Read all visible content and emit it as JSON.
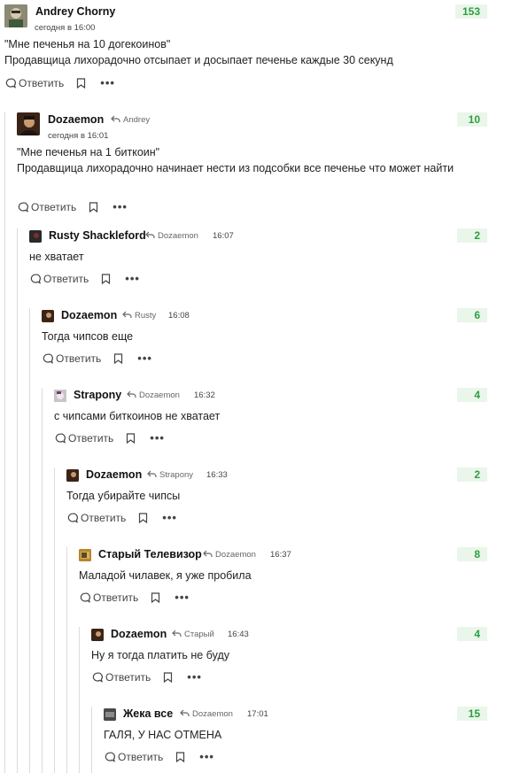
{
  "labels": {
    "reply": "Ответить"
  },
  "colors": {
    "rating_bg": "#e9f6e9",
    "rating_text": "#2f9e41",
    "thread_line": "#dcdcdc"
  },
  "comments": [
    {
      "author": "Andrey Chorny",
      "time": "сегодня в 16:00",
      "rating": "153",
      "text": "\"Мне печенья на 10 догекоинов\"\nПродавщица лихорадочно отсыпает и досыпает печенье каждые 30 секунд",
      "avatar_icon": "person-avatar-icon"
    },
    {
      "author": "Dozaemon",
      "reply_to": "Andrey",
      "time": "сегодня в 16:01",
      "rating": "10",
      "text": "\"Мне печенья на 1 биткоин\"\nПродавщица лихорадочно начинает нести из подсобки все печенье что может найти",
      "avatar_icon": "painting-avatar-icon"
    },
    {
      "author": "Rusty Shackleford",
      "reply_to": "Dozaemon",
      "time": "16:07",
      "rating": "2",
      "text": "не хватает",
      "avatar_icon": "dark-avatar-icon"
    },
    {
      "author": "Dozaemon",
      "reply_to": "Rusty",
      "time": "16:08",
      "rating": "6",
      "text": "Тогда чипсов еще",
      "avatar_icon": "painting-avatar-icon"
    },
    {
      "author": "Strapony",
      "reply_to": "Dozaemon",
      "time": "16:32",
      "rating": "4",
      "text": "с чипсами биткоинов не хватает",
      "avatar_icon": "pony-avatar-icon"
    },
    {
      "author": "Dozaemon",
      "reply_to": "Strapony",
      "time": "16:33",
      "rating": "2",
      "text": "Тогда убирайте чипсы",
      "avatar_icon": "painting-avatar-icon"
    },
    {
      "author": "Старый Телевизор",
      "reply_to": "Dozaemon",
      "time": "16:37",
      "rating": "8",
      "text": "Маладой чилавек, я уже пробила",
      "avatar_icon": "tv-avatar-icon"
    },
    {
      "author": "Dozaemon",
      "reply_to": "Старый",
      "time": "16:43",
      "rating": "4",
      "text": "Ну я тогда платить не буду",
      "avatar_icon": "painting-avatar-icon"
    },
    {
      "author": "Жека все",
      "reply_to": "Dozaemon",
      "time": "17:01",
      "rating": "15",
      "text": "ГАЛЯ, У НАС ОТМЕНА",
      "avatar_icon": "dark-avatar-icon"
    }
  ]
}
